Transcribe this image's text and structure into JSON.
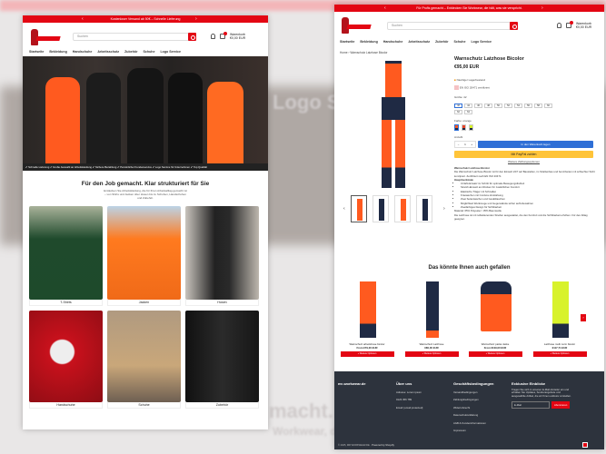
{
  "background": {
    "text_left": "Logo Service",
    "text_mid": "macht. Klar",
    "text_low": "Workwear, die"
  },
  "home": {
    "announcement": "Kostenloser Versand ab 50€ – Schnelle Lieferung",
    "search_placeholder": "Suchen",
    "cart": {
      "label": "Warenkorb",
      "total": "€0,00 EUR"
    },
    "nav": [
      "Startseite",
      "Bekleidung",
      "Handschuhe",
      "Arbeitsschutz",
      "Zubehör",
      "Schuhe",
      "Logo Service"
    ],
    "usp": "✔ Schnelle Lieferung  ✔ Große Auswahl an Arbeitskleidung  ✔ Sichere Bezahlung  ✔ Persönlicher Kundenservice  ✔ Logo Service für Unternehmen  ✔ Top Qualität",
    "section_title": "Für den Job gemacht. Klar strukturiert für Sie",
    "section_sub": "Entdecken Sie Arbeitskleidung, die für Ihren Arbeitsalltag gemacht ist – von Shirts und Jacken über Hosen bis zu Schuhen, Handschuhen und Zubehör.",
    "categories": [
      "T-Shirts",
      "Jacken",
      "Hosen",
      "Handschuhe",
      "Schuhe",
      "Zubehör"
    ]
  },
  "product": {
    "announcement": "Für Profis gemacht – Entdecken Sie Workwear, die hält, was sie verspricht.",
    "search_placeholder": "Suchen",
    "cart": {
      "label": "Warenkorb",
      "total": "€0,00 EUR"
    },
    "nav": [
      "Startseite",
      "Bekleidung",
      "Handschuhe",
      "Arbeitsschutz",
      "Zubehör",
      "Schuhe",
      "Logo Service"
    ],
    "breadcrumb": "Home › Warnschutz Latzhose Bicolor",
    "title": "Warnschutz Latzhose Bicolor",
    "price": "€95,00 EUR",
    "stock": "Niedriger Lagerbestand",
    "norm": "EN ISO 20471 zertifiziert",
    "size_label": "Größe: 42",
    "sizes": [
      "42",
      "44",
      "46",
      "48",
      "50",
      "52",
      "54",
      "56",
      "58",
      "60",
      "62",
      "64"
    ],
    "color_label": "Farbe: orange",
    "qty_label": "Anzahl",
    "qty": "1",
    "add_to_cart": "In den Warenkorb legen",
    "paypal": "Mit PayPal zahlen",
    "more_payment": "Weitere Zahlungsoptionen",
    "desc_title": "Warnschutz Latzhose Bicolor",
    "desc_intro": "Die Warnschutz Latzhose Bicolor ist für den Einsatz 24/7 auf Baustellen, im Straßenbau und bei Arbeiten mit schlechter Sicht konzipiert. Zertifiziert nach EN ISO 20471.",
    "features_title": "Hauptmerkmale",
    "features": [
      "3-Naht-Einsatz im Schritt für optimale Bewegungsfreiheit",
      "Stretch-Einsatz am Rücken für zusätzlichen Komfort",
      "Elastische Träger mit Schnallen",
      "Knietaschen mit Cordura-Verstärkung",
      "Zwei Seitentaschen und Gesäßtaschen",
      "Möglichkeit Werkzeuge und Gegenstände sicher aufzubewahren",
      "Zweifarbiges Design für Sichtbarkeit"
    ],
    "material": "Material: 65% Polyester / 35% Baumwolle",
    "desc_outro": "Die Latzhose ist mit reflektierenden Streifen ausgestattet, die den Komfort und die Sichtbarkeit erhöhen. Für den Alltag geeignet.",
    "recs_title": "Das könnte Ihnen auch gefallen",
    "recs": [
      {
        "name": "Warnschutz arbeitshose bicolor",
        "price": "From €79,00 EUR",
        "button": "+ Weitere Optionen"
      },
      {
        "name": "Warnschutz Latzhose",
        "price": "€80,00 EUR",
        "button": "+ Weitere Optionen"
      },
      {
        "name": "Warnschutz parka Jacke",
        "price": "From €109,00 EUR",
        "button": "+ Weitere Optionen"
      },
      {
        "name": "Latzhose multi norm bicolor",
        "price": "€117,71 EUR",
        "button": "+ Weitere Optionen"
      }
    ],
    "footer": {
      "brand": "mr-workwear.de",
      "about_title": "Über uns",
      "about": [
        "Adresse: Lorem ipsum",
        "0123 456 789",
        "Email: [email protected]"
      ],
      "terms_title": "Geschäftsbedingungen",
      "terms": [
        "Versandbedingungen",
        "Zahlungsbedingungen",
        "Widerrufsrecht",
        "Datenschutzerklärung",
        "AGB & Kundeninformationen",
        "Impressum"
      ],
      "news_title": "Exklusive Einblicke",
      "news_text": "Tragen Sie sich in unseren E-Mail-Verteiler ein und erhalten Sie Updates, Sonderangebote und ausgewählte Artikel, die wir Ihnen exklusiv vorstellen.",
      "email_placeholder": "E-Mail",
      "subscribe": "Abonnieren",
      "copyright": "© 2025, MR WORKWEAR.DE",
      "powered": "Powered by Shopify"
    }
  },
  "colors": {
    "brand_red": "#e30613",
    "footer": "#2d333d",
    "paypal": "#ffc439",
    "cart_blue": "#2f6fd6",
    "hivis_orange": "#ff5a1f",
    "navy": "#1f2a44"
  }
}
